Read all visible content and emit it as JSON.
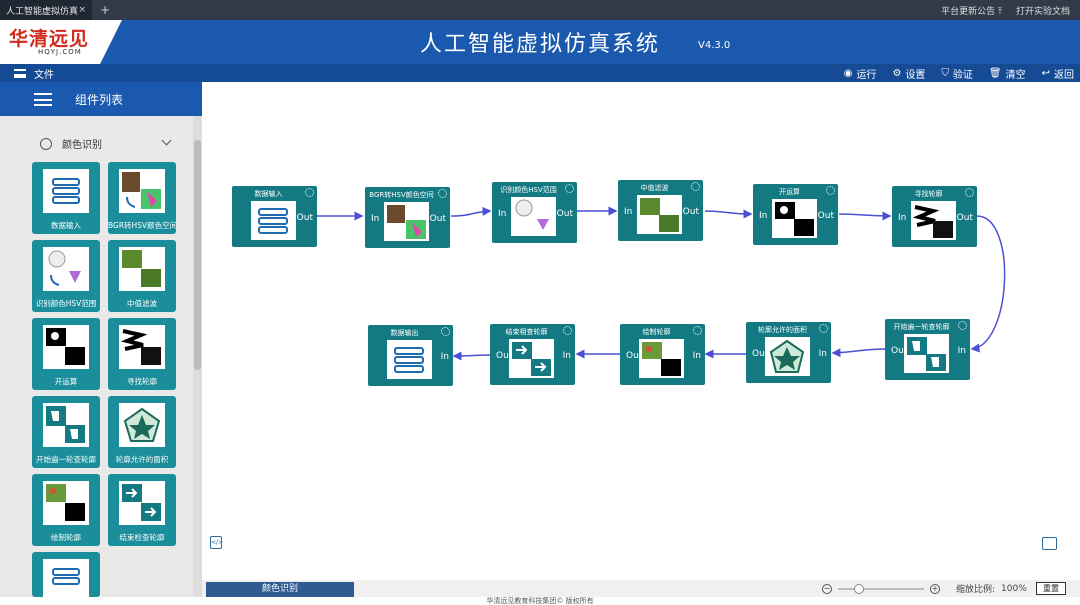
{
  "browser": {
    "tab_title": "人工智能虚拟仿真",
    "tab_close": "×",
    "new_tab": "+",
    "right_items": [
      {
        "label": "平台更新公告",
        "icon": "pin-icon"
      },
      {
        "label": "打开实验文档"
      }
    ]
  },
  "header": {
    "logo_text": "华清远见",
    "logo_sub": "HQYJ.COM",
    "title": "人工智能虚拟仿真系统",
    "version": "V4.3.0"
  },
  "toolbar": {
    "file_label": "文件",
    "actions": [
      {
        "label": "运行",
        "icon": "play-icon"
      },
      {
        "label": "设置",
        "icon": "gear-icon"
      },
      {
        "label": "验证",
        "icon": "shield-icon"
      },
      {
        "label": "清空",
        "icon": "trash-icon"
      },
      {
        "label": "返回",
        "icon": "back-icon"
      }
    ]
  },
  "sidebar": {
    "title": "组件列表",
    "category": "颜色识别",
    "components": [
      "数据输入",
      "BGR转HSV颜色空间",
      "识别颜色HSV范围",
      "中值滤波",
      "开运算",
      "寻找轮廓",
      "开始遍一轮查轮廓",
      "轮廓允许的面积",
      "绘制轮廓",
      "结束检查轮廓",
      ""
    ]
  },
  "canvas": {
    "nodes": [
      {
        "title": "数据输入",
        "in": "",
        "out": "Out",
        "thumb": "data-input-icon"
      },
      {
        "title": "BGR转HSV颜色空间",
        "in": "In",
        "out": "Out",
        "thumb": "hsv-conversion-icon"
      },
      {
        "title": "识别颜色HSV范围",
        "in": "In",
        "out": "Out",
        "thumb": "color-range-icon"
      },
      {
        "title": "中值滤波",
        "in": "In",
        "out": "Out",
        "thumb": "median-filter-icon"
      },
      {
        "title": "开运算",
        "in": "In",
        "out": "Out",
        "thumb": "opening-icon"
      },
      {
        "title": "寻找轮廓",
        "in": "In",
        "out": "Out",
        "thumb": "find-contours-icon"
      },
      {
        "title": "开始遍一轮查轮廓",
        "in": "In",
        "out": "Out",
        "thumb": "contour-loop-icon"
      },
      {
        "title": "轮廓允许的面积",
        "in": "In",
        "out": "Out",
        "thumb": "contour-area-icon"
      },
      {
        "title": "绘制轮廓",
        "in": "In",
        "out": "Out",
        "thumb": "draw-contours-icon"
      },
      {
        "title": "结束相查轮廓",
        "in": "In",
        "out": "Out",
        "thumb": "end-loop-icon"
      },
      {
        "title": "数据输出",
        "in": "In",
        "out": "",
        "thumb": "data-output-icon"
      }
    ]
  },
  "footer": {
    "tab": "颜色识别",
    "zoom_label": "缩放比例:",
    "zoom_value": "100%",
    "zoom_level": 1.0,
    "reset": "重置",
    "copyright": "华清远见教育科技集团© 版权所有"
  },
  "colors": {
    "header": "#1a59ad",
    "node": "#137a83",
    "card": "#1b8e9c",
    "edge": "#4a4fd6"
  }
}
